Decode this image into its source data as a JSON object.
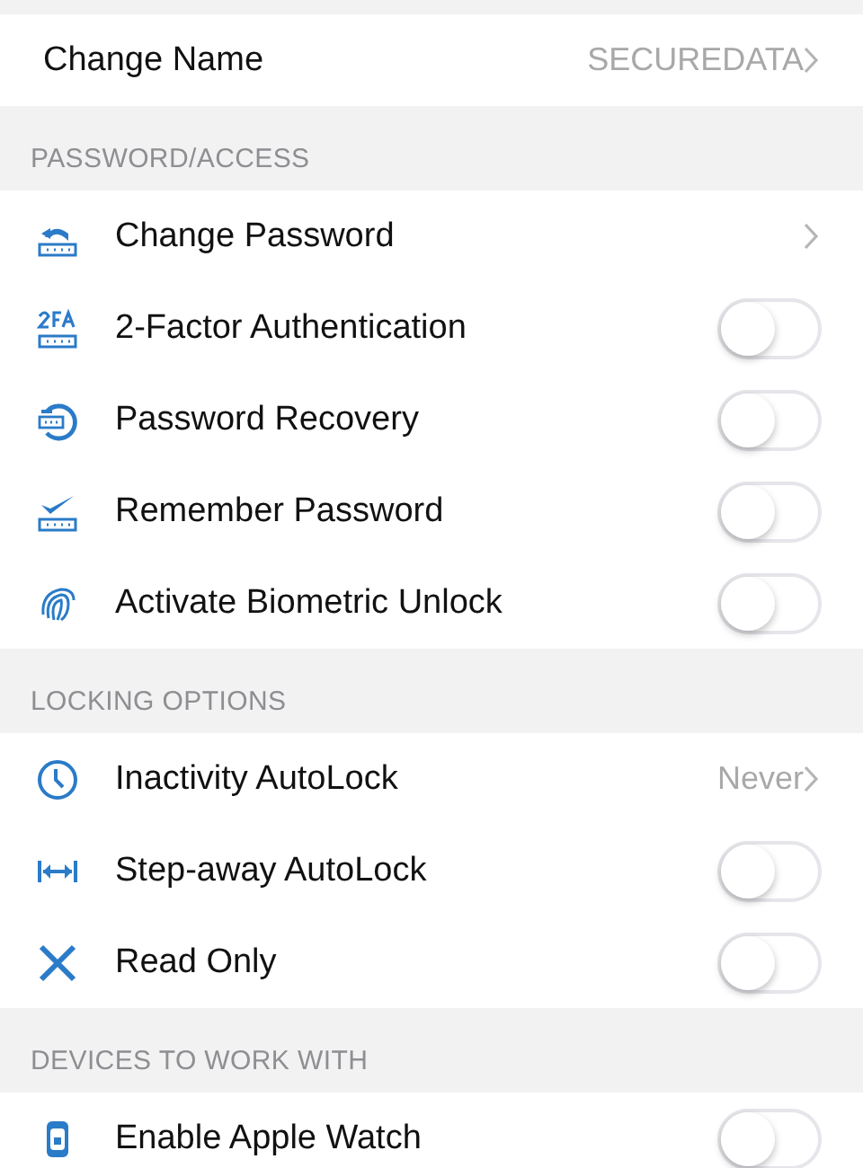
{
  "sections": [
    {
      "items": [
        {
          "kind": "link",
          "label": "Change Name",
          "value": "SECUREDATA"
        }
      ]
    },
    {
      "header": "PASSWORD/ACCESS",
      "items": [
        {
          "kind": "link",
          "label": "Change Password"
        },
        {
          "kind": "toggle",
          "label": "2-Factor Authentication",
          "on": false
        },
        {
          "kind": "toggle",
          "label": "Password Recovery",
          "on": false
        },
        {
          "kind": "toggle",
          "label": "Remember Password",
          "on": false
        },
        {
          "kind": "toggle",
          "label": "Activate Biometric Unlock",
          "on": false
        }
      ]
    },
    {
      "header": "LOCKING OPTIONS",
      "items": [
        {
          "kind": "link",
          "label": "Inactivity AutoLock",
          "value": "Never"
        },
        {
          "kind": "toggle",
          "label": "Step-away AutoLock",
          "on": false
        },
        {
          "kind": "toggle",
          "label": "Read Only",
          "on": false
        }
      ]
    },
    {
      "header": "DEVICES TO WORK WITH",
      "items": [
        {
          "kind": "toggle",
          "label": "Enable Apple Watch",
          "on": false
        }
      ]
    }
  ]
}
